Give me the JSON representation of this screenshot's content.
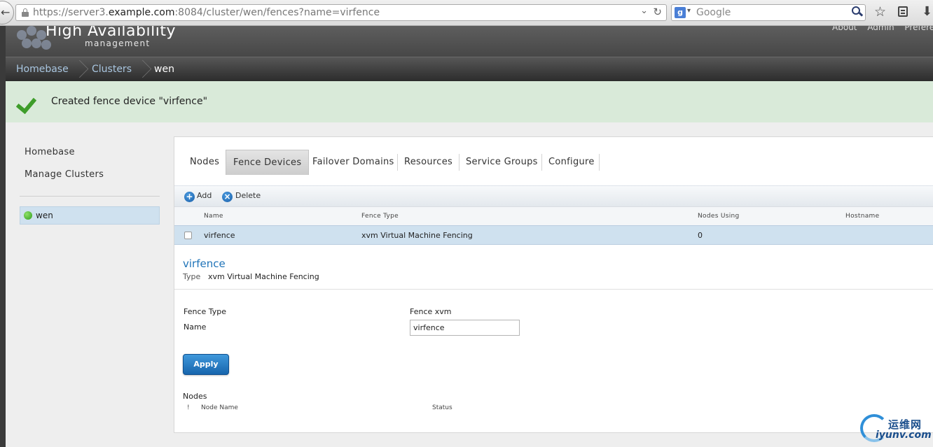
{
  "browser": {
    "url_prefix": "https://server3.",
    "url_domain": "example.com",
    "url_suffix": ":8084/cluster/wen/fences?name=virfence",
    "search_placeholder": "Google",
    "dropdown_glyph": "⌄",
    "reload_glyph": "↻",
    "back_glyph": "←",
    "star_glyph": "☆",
    "download_glyph": "⬇",
    "google_glyph": "g",
    "search_caret": "▾"
  },
  "header": {
    "title": "High Availability",
    "subtitle": "management",
    "links": [
      "About",
      "Admin",
      "Preferences"
    ]
  },
  "breadcrumb": {
    "items": [
      "Homebase",
      "Clusters",
      "wen"
    ]
  },
  "flash": {
    "message": "Created fence device \"virfence\""
  },
  "sidebar": {
    "links": [
      "Homebase",
      "Manage Clusters"
    ],
    "cluster": "wen",
    "cluster_status_color": "#3fae2a"
  },
  "tabs": [
    "Nodes",
    "Fence Devices",
    "Failover Domains",
    "Resources",
    "Service Groups",
    "Configure"
  ],
  "active_tab": "Fence Devices",
  "toolbar": {
    "add_label": "Add",
    "delete_label": "Delete",
    "add_glyph": "+",
    "delete_glyph": "×"
  },
  "table": {
    "headers": [
      "Name",
      "Fence Type",
      "Nodes Using",
      "Hostname"
    ],
    "rows": [
      {
        "name": "virfence",
        "fence_type": "xvm Virtual Machine Fencing",
        "nodes_using": "0",
        "hostname": ""
      }
    ]
  },
  "detail": {
    "title": "virfence",
    "type_label": "Type",
    "type_value": "xvm Virtual Machine Fencing",
    "fence_type_label": "Fence Type",
    "fence_type_value": "Fence xvm",
    "name_label": "Name",
    "name_value": "virfence",
    "apply_label": "Apply",
    "nodes_label": "Nodes",
    "nodes_headers": [
      "!",
      "Node Name",
      "Status"
    ]
  },
  "watermark": {
    "cn": "运维网",
    "en": "iyunv.com"
  },
  "colors": {
    "accent": "#1e73b8",
    "flash_bg": "#d9ead9",
    "selected_row": "#cfe1ef"
  }
}
